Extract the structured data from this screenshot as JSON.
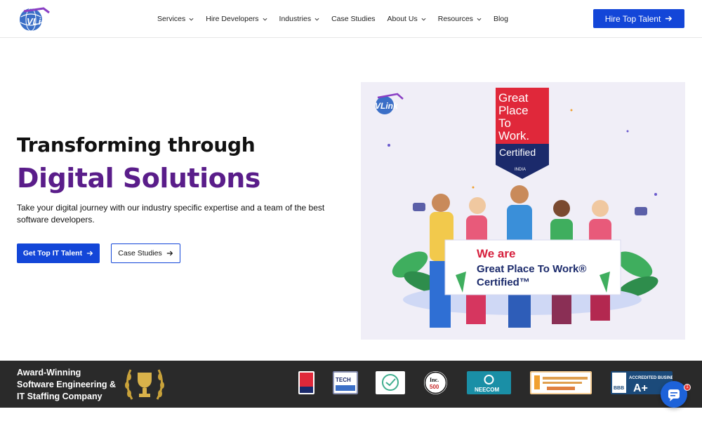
{
  "header": {
    "logo_text": "VLink",
    "nav": [
      {
        "label": "Services",
        "has_dropdown": true
      },
      {
        "label": "Hire Developers",
        "has_dropdown": true
      },
      {
        "label": "Industries",
        "has_dropdown": true
      },
      {
        "label": "Case Studies",
        "has_dropdown": false
      },
      {
        "label": "About Us",
        "has_dropdown": true
      },
      {
        "label": "Resources",
        "has_dropdown": true
      },
      {
        "label": "Blog",
        "has_dropdown": false
      }
    ],
    "cta_label": "Hire Top Talent",
    "cta_icon": "arrow-right-icon"
  },
  "hero": {
    "title_line1": "Transforming through",
    "title_line2": "Digital Solutions",
    "description": "Take your digital journey with our industry specific expertise and a team of the best software developers.",
    "primary_button": "Get Top IT Talent",
    "secondary_button": "Case Studies",
    "image": {
      "logo_text": "VLink",
      "gptw_badge": [
        "Great",
        "Place",
        "To",
        "Work.",
        "Certified",
        "INDIA"
      ],
      "banner_line1": "We are",
      "banner_line2": "Great Place To Work®",
      "banner_line3": "Certified™"
    }
  },
  "award_bar": {
    "text_lines": [
      "Award-Winning",
      "Software Engineering &",
      "IT Staffing Company"
    ],
    "badges": [
      {
        "name": "great-place-to-work-badge",
        "label": "Great Place To Work Certified"
      },
      {
        "name": "connect-tech-badge",
        "label": "Connect TECH"
      },
      {
        "name": "expertise-badge",
        "label": "Expertise.com"
      },
      {
        "name": "inc-5000-badge",
        "label": "Inc. 5000"
      },
      {
        "name": "neecom-badge",
        "label": "NEECOM"
      },
      {
        "name": "best-places-to-work-badge",
        "label": "BEST PLACES TO WORK IN CONNECTICUT"
      },
      {
        "name": "bbb-badge",
        "label": "ACCREDITED BUSINESS A+ Rating"
      }
    ],
    "chat_badge_count": "1"
  },
  "colors": {
    "primary": "#1346d8",
    "accent_purple": "#5a1d8a",
    "award_bar_bg": "#2a2a2a"
  }
}
